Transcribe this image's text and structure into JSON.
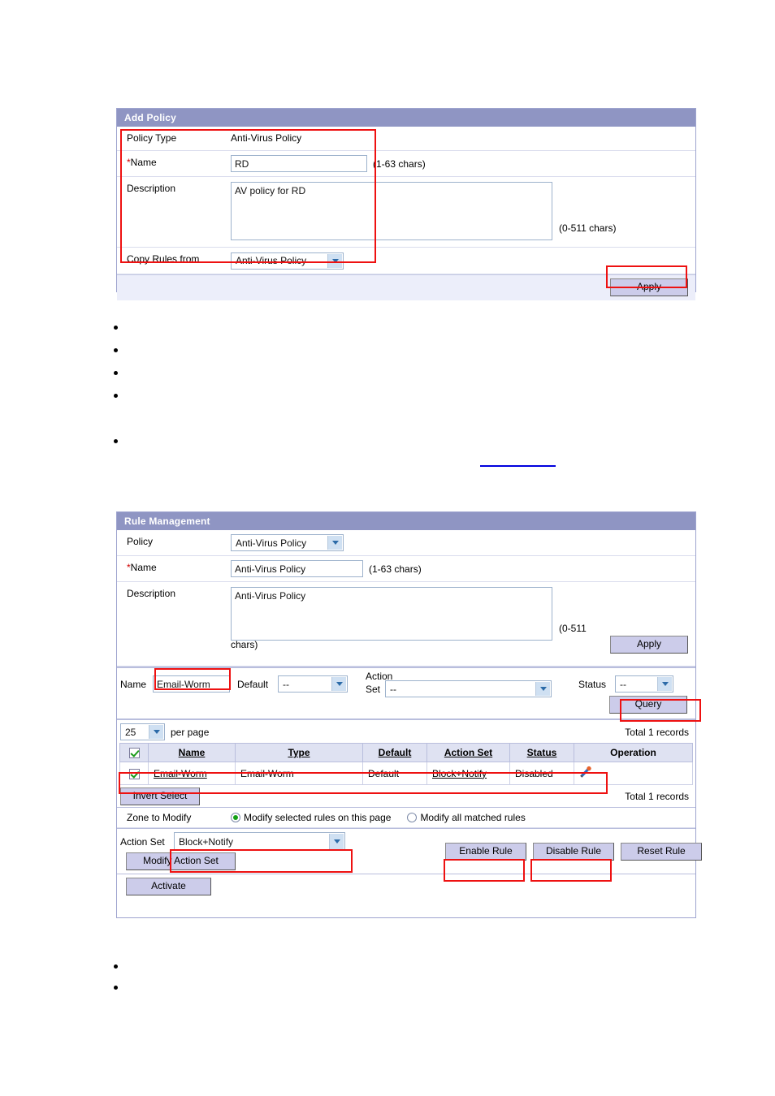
{
  "add_policy": {
    "title": "Add Policy",
    "fields": {
      "policy_type_label": "Policy Type",
      "policy_type_value": "Anti-Virus Policy",
      "name_label": "Name",
      "name_required_mark": "*",
      "name_value": "RD",
      "name_hint": "(1-63  chars)",
      "description_label": "Description",
      "description_value": "AV policy for RD",
      "description_hint": "(0-511  chars)",
      "copy_rules_label": "Copy Rules from",
      "copy_rules_value": "Anti-Virus Policy"
    },
    "apply_label": "Apply"
  },
  "rule_management": {
    "title": "Rule Management",
    "fields": {
      "policy_label": "Policy",
      "policy_value": "Anti-Virus Policy",
      "name_label": "Name",
      "name_required_mark": "*",
      "name_value": "Anti-Virus Policy",
      "name_hint": "(1-63  chars)",
      "description_label": "Description",
      "description_value": "Anti-Virus Policy",
      "description_hint_part1": "(0-511",
      "description_hint_part2": "chars)"
    },
    "apply_label": "Apply",
    "query_bar": {
      "name_label": "Name",
      "name_value": "Email-Worm",
      "default_label": "Default",
      "default_value": "--",
      "action_set_label_line1": "Action",
      "action_set_label_line2": "Set",
      "action_set_value": "--",
      "status_label": "Status",
      "status_value": "--",
      "query_label": "Query"
    },
    "paging": {
      "per_page_value": "25",
      "per_page_label": "per page",
      "total_top": "Total 1 records",
      "total_bottom": "Total 1 records"
    },
    "table": {
      "select_all_checked": true,
      "headers": [
        "Name",
        "Type",
        "Default",
        "Action Set",
        "Status",
        "Operation"
      ],
      "rows": [
        {
          "checked": true,
          "name": "Email-Worm",
          "type": "Email-Worm",
          "default": "Default",
          "action_set": "Block+Notify",
          "status": "Disabled",
          "operation_icon": "pencil-icon"
        }
      ]
    },
    "invert_select_label": "Invert Select",
    "zone_to_modify": {
      "label": "Zone to Modify",
      "option_selected": "Modify selected rules on this page",
      "option_all": "Modify all matched rules"
    },
    "action_bar": {
      "action_set_label": "Action Set",
      "action_set_value": "Block+Notify",
      "modify_action_set_label": "Modify Action Set",
      "enable_rule_label": "Enable Rule",
      "disable_rule_label": "Disable Rule",
      "reset_rule_label": "Reset Rule",
      "activate_label": "Activate"
    }
  },
  "colors": {
    "panel_header": "#8f95c3",
    "button_face": "#ccccea",
    "highlight": "#ee1111",
    "table_header": "#dfe2f2",
    "link_blue": "#0000dd"
  }
}
